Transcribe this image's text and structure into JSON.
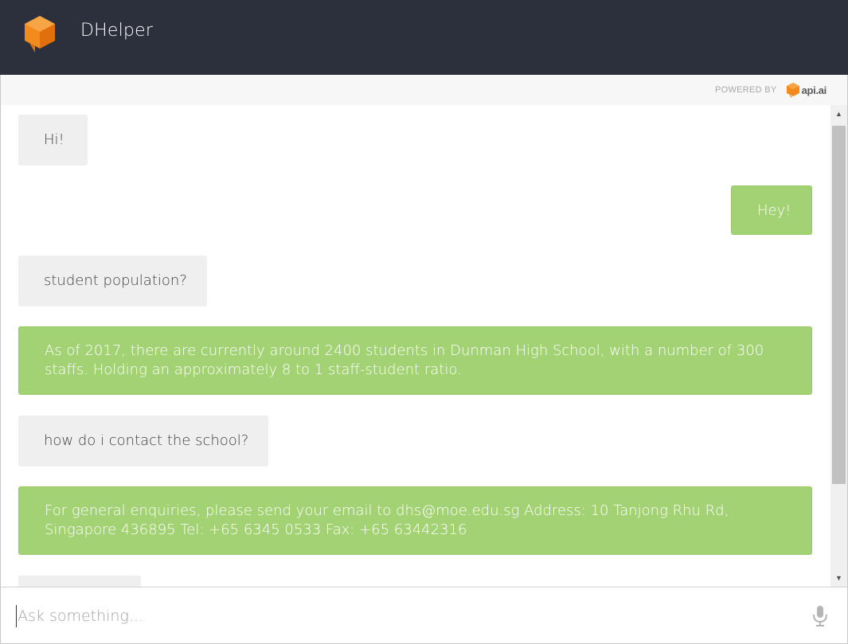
{
  "app": {
    "title": "DHelper"
  },
  "powered": {
    "label": "POWERED BY",
    "brand": "api.ai"
  },
  "colors": {
    "header_bg": "#2b303c",
    "bot_bubble": "#a3d274",
    "user_bubble": "#efefef",
    "brand_orange": "#f28a1c"
  },
  "messages": [
    {
      "role": "user",
      "text": "Hi!"
    },
    {
      "role": "bot",
      "text": "Hey!"
    },
    {
      "role": "user",
      "text": "student population?"
    },
    {
      "role": "bot",
      "text": "As of 2017, there are currently around 2400 students in Dunman High School, with a number of 300 staffs. Holding an approximately 8 to 1 staff-student ratio."
    },
    {
      "role": "user",
      "text": "how do i contact the school?"
    },
    {
      "role": "bot",
      "text": "For general enquiries, please send your email to dhs@moe.edu.sg Address: 10 Tanjong Rhu Rd, Singapore 436895 Tel: +65 6345 0533 Fax: +65 63442316"
    },
    {
      "role": "user",
      "text": ""
    }
  ],
  "input": {
    "placeholder": "Ask something...",
    "value": ""
  },
  "icons": {
    "logo": "cube-logo-icon",
    "mic": "microphone-icon",
    "scroll_up": "scroll-up-arrow-icon",
    "scroll_down": "scroll-down-arrow-icon"
  }
}
